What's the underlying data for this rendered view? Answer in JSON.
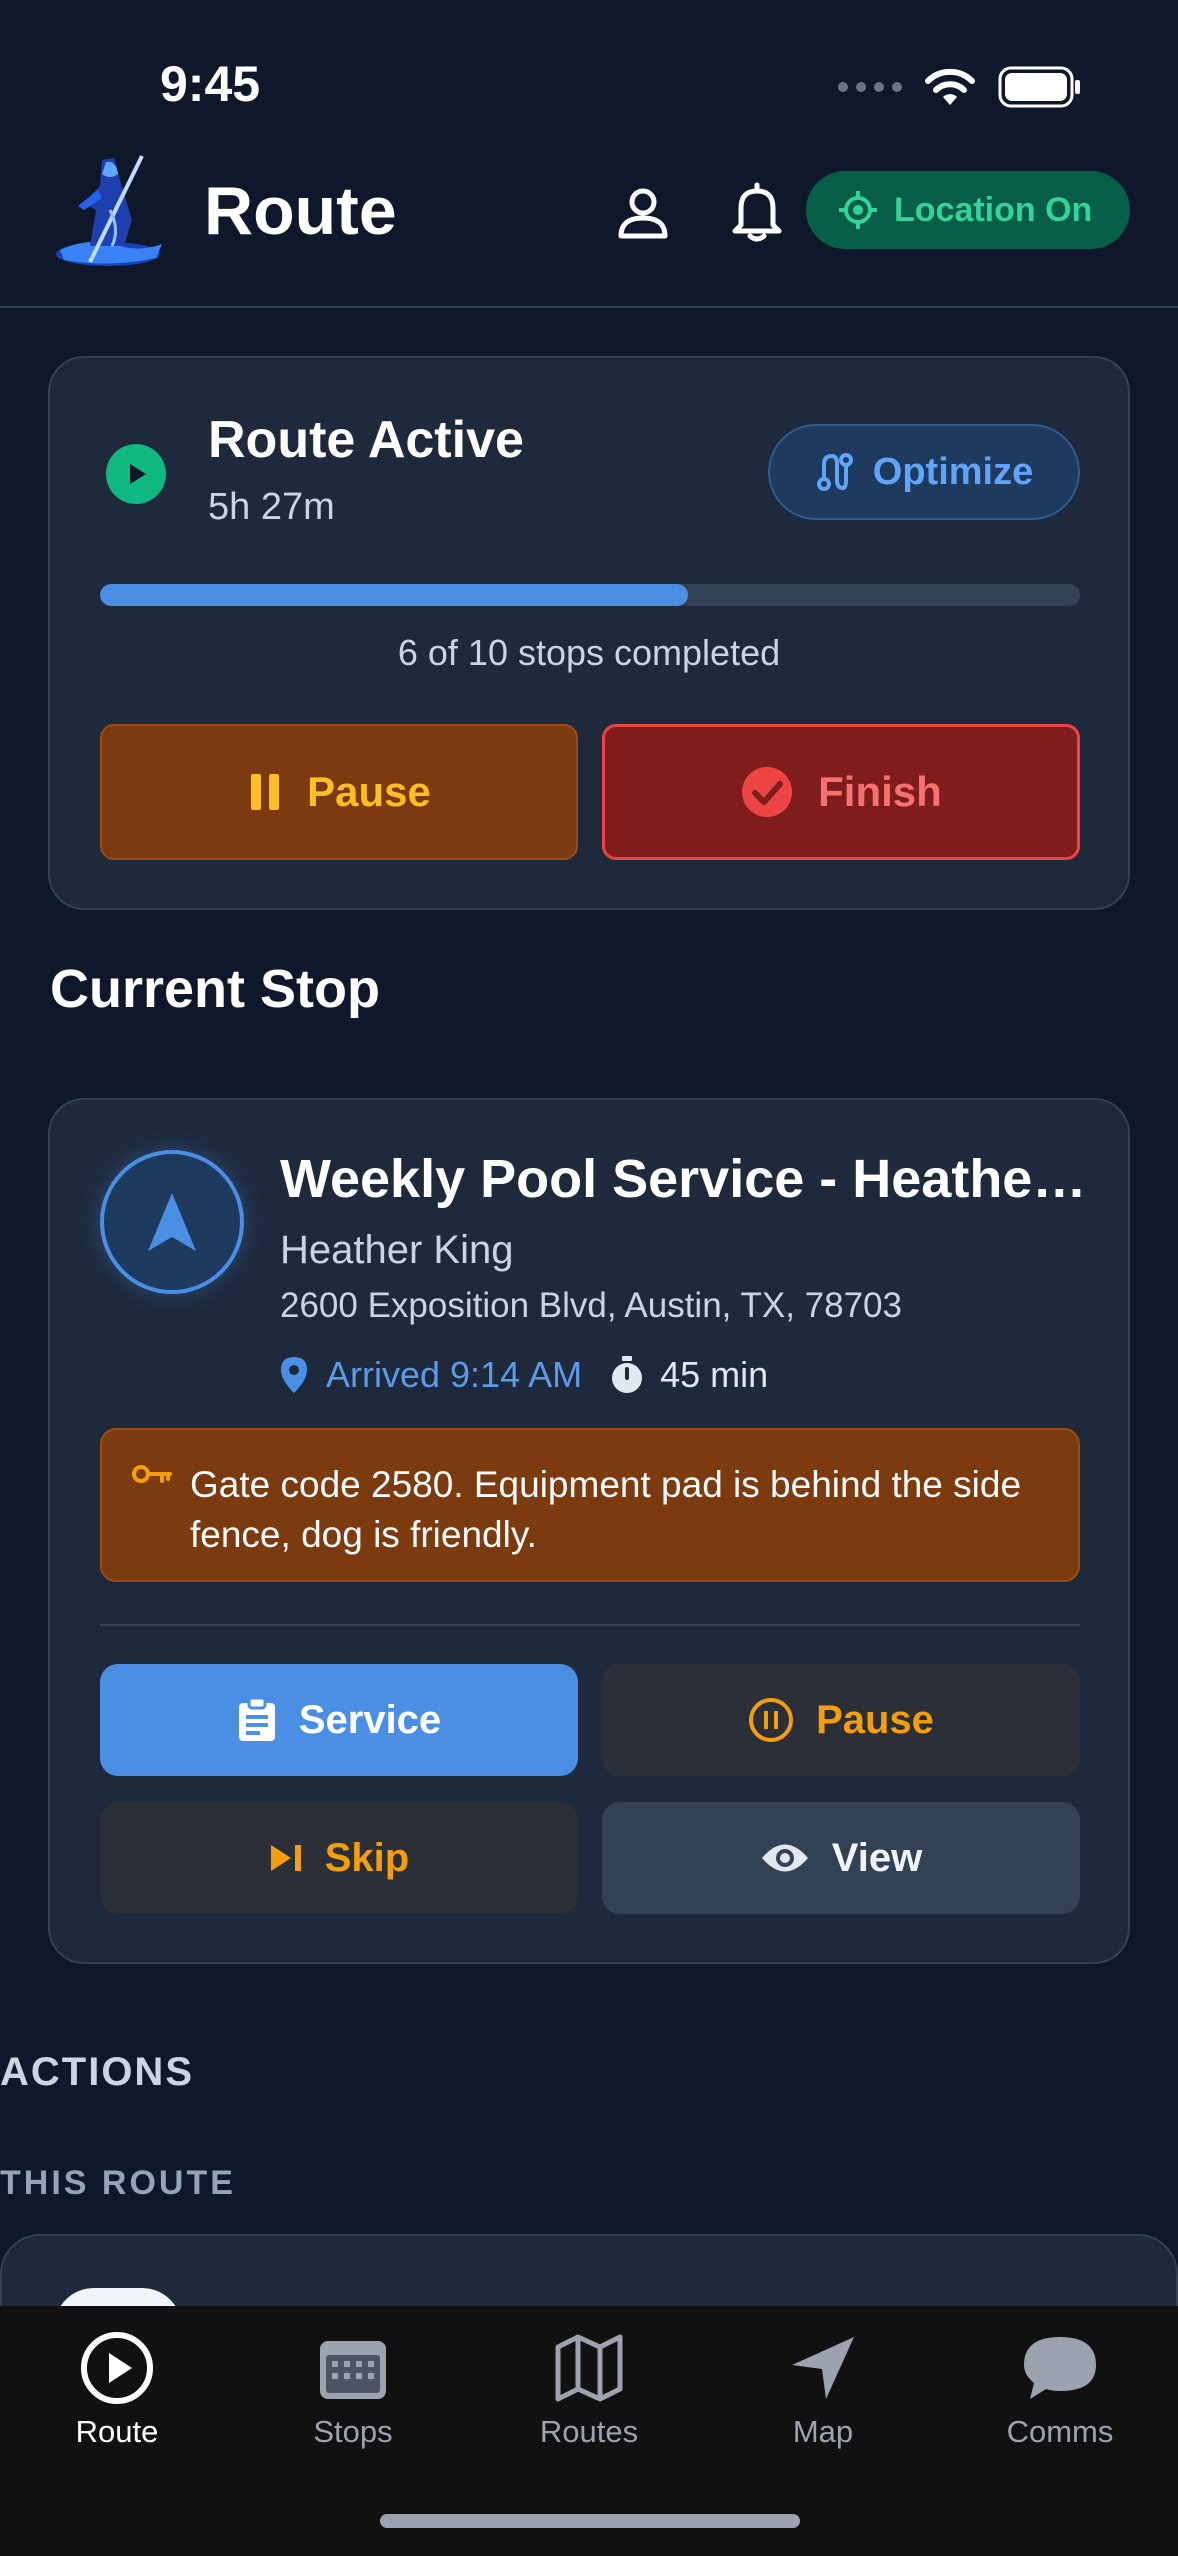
{
  "status_bar": {
    "time": "9:45"
  },
  "header": {
    "title": "Route",
    "location_label": "Location On"
  },
  "route_card": {
    "status": "Route Active",
    "elapsed": "5h 27m",
    "optimize_label": "Optimize",
    "progress_fraction": 0.6,
    "progress_text": "6 of 10 stops completed",
    "pause_label": "Pause",
    "finish_label": "Finish"
  },
  "current_stop": {
    "section_title": "Current Stop",
    "title": "Weekly Pool Service - Heather King",
    "customer": "Heather King",
    "address": "2600 Exposition Blvd, Austin, TX, 78703",
    "arrived": "Arrived 9:14 AM",
    "duration": "45 min",
    "note": "Gate code 2580. Equipment pad is behind the side fence, dog is friendly.",
    "service_label": "Service",
    "pause_label": "Pause",
    "skip_label": "Skip",
    "view_label": "View"
  },
  "actions": {
    "heading": "ACTIONS",
    "subheading": "THIS ROUTE"
  },
  "tabs": [
    {
      "label": "Route",
      "icon": "play-circle-icon",
      "active": true
    },
    {
      "label": "Stops",
      "icon": "calendar-grid-icon",
      "active": false
    },
    {
      "label": "Routes",
      "icon": "map-icon",
      "active": false
    },
    {
      "label": "Map",
      "icon": "navigation-arrow-icon",
      "active": false
    },
    {
      "label": "Comms",
      "icon": "chat-bubble-icon",
      "active": false
    }
  ],
  "colors": {
    "background": "#0f172a",
    "card": "#1e293b",
    "accent_blue": "#4a8fe4",
    "success_green": "#10b981",
    "warning_amber": "#f59e0b",
    "danger_red": "#ef4444"
  }
}
